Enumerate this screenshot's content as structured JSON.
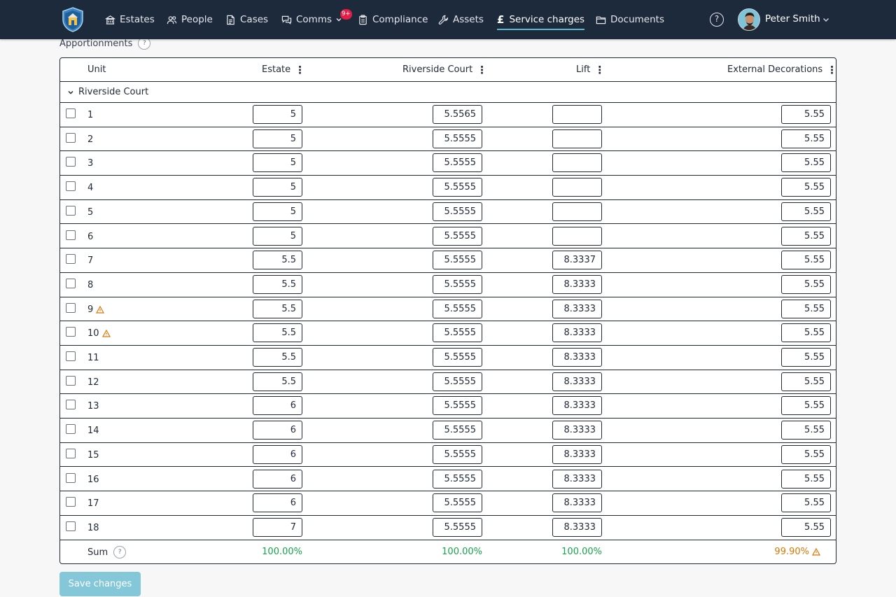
{
  "nav": {
    "items": [
      {
        "label": "Estates",
        "icon": "building-icon"
      },
      {
        "label": "People",
        "icon": "people-icon"
      },
      {
        "label": "Cases",
        "icon": "document-icon"
      },
      {
        "label": "Comms",
        "icon": "chat-icon"
      },
      {
        "label": "Compliance",
        "icon": "clipboard-icon"
      },
      {
        "label": "Assets",
        "icon": "wrench-icon"
      },
      {
        "label": "Service charges",
        "icon": "pound-icon",
        "active": true
      },
      {
        "label": "Documents",
        "icon": "folder-icon"
      }
    ],
    "comms_badge": "9+",
    "help": "?",
    "user_name": "Peter Smith"
  },
  "section": {
    "title": "Apportionments",
    "help": "?"
  },
  "table": {
    "columns": {
      "unit": "Unit",
      "estate": "Estate",
      "riverside": "Riverside Court",
      "lift": "Lift",
      "ext": "External Decorations"
    },
    "menu_glyph": "⋮",
    "group": "Riverside Court",
    "rows": [
      {
        "unit": "1",
        "estate": "5",
        "riverside": "5.5565",
        "lift": "",
        "ext": "5.55",
        "warning": false
      },
      {
        "unit": "2",
        "estate": "5",
        "riverside": "5.5555",
        "lift": "",
        "ext": "5.55",
        "warning": false
      },
      {
        "unit": "3",
        "estate": "5",
        "riverside": "5.5555",
        "lift": "",
        "ext": "5.55",
        "warning": false
      },
      {
        "unit": "4",
        "estate": "5",
        "riverside": "5.5555",
        "lift": "",
        "ext": "5.55",
        "warning": false
      },
      {
        "unit": "5",
        "estate": "5",
        "riverside": "5.5555",
        "lift": "",
        "ext": "5.55",
        "warning": false
      },
      {
        "unit": "6",
        "estate": "5",
        "riverside": "5.5555",
        "lift": "",
        "ext": "5.55",
        "warning": false
      },
      {
        "unit": "7",
        "estate": "5.5",
        "riverside": "5.5555",
        "lift": "8.3337",
        "ext": "5.55",
        "warning": false
      },
      {
        "unit": "8",
        "estate": "5.5",
        "riverside": "5.5555",
        "lift": "8.3333",
        "ext": "5.55",
        "warning": false
      },
      {
        "unit": "9",
        "estate": "5.5",
        "riverside": "5.5555",
        "lift": "8.3333",
        "ext": "5.55",
        "warning": true
      },
      {
        "unit": "10",
        "estate": "5.5",
        "riverside": "5.5555",
        "lift": "8.3333",
        "ext": "5.55",
        "warning": true
      },
      {
        "unit": "11",
        "estate": "5.5",
        "riverside": "5.5555",
        "lift": "8.3333",
        "ext": "5.55",
        "warning": false
      },
      {
        "unit": "12",
        "estate": "5.5",
        "riverside": "5.5555",
        "lift": "8.3333",
        "ext": "5.55",
        "warning": false
      },
      {
        "unit": "13",
        "estate": "6",
        "riverside": "5.5555",
        "lift": "8.3333",
        "ext": "5.55",
        "warning": false
      },
      {
        "unit": "14",
        "estate": "6",
        "riverside": "5.5555",
        "lift": "8.3333",
        "ext": "5.55",
        "warning": false
      },
      {
        "unit": "15",
        "estate": "6",
        "riverside": "5.5555",
        "lift": "8.3333",
        "ext": "5.55",
        "warning": false
      },
      {
        "unit": "16",
        "estate": "6",
        "riverside": "5.5555",
        "lift": "8.3333",
        "ext": "5.55",
        "warning": false
      },
      {
        "unit": "17",
        "estate": "6",
        "riverside": "5.5555",
        "lift": "8.3333",
        "ext": "5.55",
        "warning": false
      },
      {
        "unit": "18",
        "estate": "7",
        "riverside": "5.5555",
        "lift": "8.3333",
        "ext": "5.55",
        "warning": false
      }
    ],
    "sum": {
      "label": "Sum",
      "help": "?",
      "estate": "100.00%",
      "riverside": "100.00%",
      "lift": "100.00%",
      "ext": "99.90%",
      "ext_warning": true
    }
  },
  "actions": {
    "save_label": "Save changes"
  },
  "colors": {
    "nav_bg": "#1d2a3b",
    "accent": "#5fb8cf",
    "badge": "#e11d48",
    "ok": "#16a34a",
    "warn": "#d97706",
    "save_disabled": "#84c7d8"
  }
}
